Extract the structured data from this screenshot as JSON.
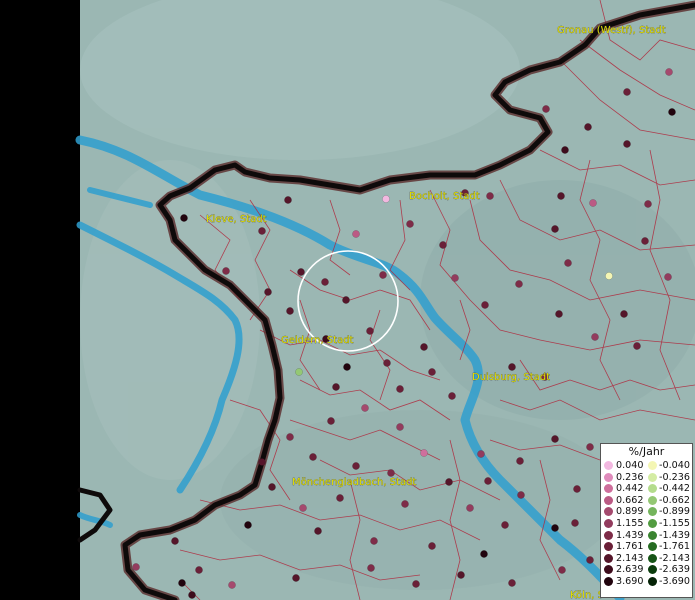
{
  "map": {
    "cities": [
      {
        "id": "gronau",
        "label": "Gronau (Westf), Stadt"
      },
      {
        "id": "bocholt",
        "label": "Bocholt, Stadt"
      },
      {
        "id": "kleve",
        "label": "Kleve, Stadt"
      },
      {
        "id": "geldern",
        "label": "Geldern, Stadt"
      },
      {
        "id": "duisburg",
        "label": "Duisburg, Stadt"
      },
      {
        "id": "moenchengladbach",
        "label": "Mönchengladbach, Stadt"
      },
      {
        "id": "koeln",
        "label": "Köln, S"
      }
    ],
    "colors": {
      "background_left": "#000000",
      "terrain": "#9bb7b3",
      "river": "#2f9fcf",
      "border": "#1a1212",
      "district_lines": "#b0283c",
      "label_text": "#e2e000",
      "selection_circle": "#ffffff"
    }
  },
  "legend": {
    "title": "%/Jahr",
    "positive": [
      {
        "value": "0.040",
        "color": "#f2b8e0"
      },
      {
        "value": "0.236",
        "color": "#e08cbc"
      },
      {
        "value": "0.442",
        "color": "#cf6e9c"
      },
      {
        "value": "0.662",
        "color": "#bb5a84"
      },
      {
        "value": "0.899",
        "color": "#a54a6e"
      },
      {
        "value": "1.155",
        "color": "#933c5e"
      },
      {
        "value": "1.439",
        "color": "#7e2c48"
      },
      {
        "value": "1.761",
        "color": "#6a2038"
      },
      {
        "value": "2.143",
        "color": "#55162a"
      },
      {
        "value": "2.639",
        "color": "#3e0c1c"
      },
      {
        "value": "3.690",
        "color": "#22040e"
      }
    ],
    "negative": [
      {
        "value": "-0.040",
        "color": "#f4f6b4"
      },
      {
        "value": "-0.236",
        "color": "#d4eca4"
      },
      {
        "value": "-0.442",
        "color": "#b4dc8c"
      },
      {
        "value": "-0.662",
        "color": "#94c874"
      },
      {
        "value": "-0.899",
        "color": "#74b45c"
      },
      {
        "value": "-1.155",
        "color": "#529c40"
      },
      {
        "value": "-1.439",
        "color": "#3a8430"
      },
      {
        "value": "-1.761",
        "color": "#266c22"
      },
      {
        "value": "-2.143",
        "color": "#165416"
      },
      {
        "value": "-2.639",
        "color": "#0a3c0c"
      },
      {
        "value": "-3.690",
        "color": "#042206"
      }
    ]
  }
}
